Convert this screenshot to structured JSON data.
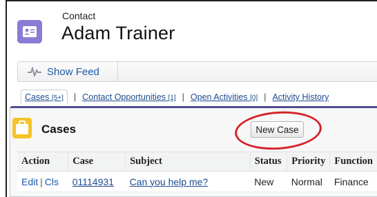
{
  "header": {
    "object_label": "Contact",
    "record_name": "Adam Trainer"
  },
  "feed": {
    "show_feed_label": "Show Feed"
  },
  "related_links": [
    {
      "label": "Cases",
      "count": "[5+]"
    },
    {
      "label": "Contact Opportunities",
      "count": "[1]"
    },
    {
      "label": "Open Activities",
      "count": "[0]"
    },
    {
      "label": "Activity History",
      "count": ""
    }
  ],
  "cases": {
    "title": "Cases",
    "new_case_label": "New Case",
    "columns": [
      "Action",
      "Case",
      "Subject",
      "Status",
      "Priority",
      "Function"
    ],
    "rows": [
      {
        "edit": "Edit",
        "close": "Cls",
        "case_number": "01114931",
        "subject": "Can you help me?",
        "status": "New",
        "priority": "Normal",
        "function": "Finance"
      }
    ]
  },
  "colors": {
    "contact_icon": "#8c7bd6",
    "case_icon": "#f4c329",
    "panel_accent": "#4e4c8f",
    "link": "#1d4b8f",
    "annotation": "#d4242a"
  },
  "icons": {
    "contact": "contact-card-icon",
    "feed": "pulse-icon",
    "cases": "briefcase-icon"
  }
}
